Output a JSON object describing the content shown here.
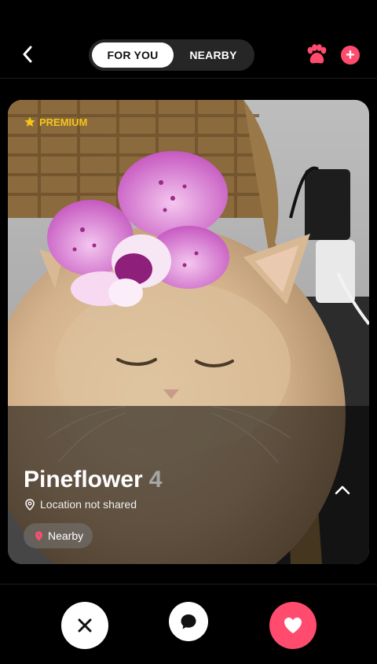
{
  "colors": {
    "accent": "#ff4b6e",
    "premium": "#f5c518",
    "background": "#000000"
  },
  "header": {
    "back_icon": "chevron-left-icon",
    "tabs": [
      {
        "label": "FOR YOU",
        "active": true
      },
      {
        "label": "NEARBY",
        "active": false
      }
    ],
    "paw_icon": "paw-icon",
    "add_icon": "plus-circle-icon",
    "add_glyph": "+"
  },
  "profile": {
    "badge": "PREMIUM",
    "name": "Pineflower",
    "age": "4",
    "location": "Location not shared",
    "chip": "Nearby",
    "expand_icon": "chevron-up-icon"
  },
  "actions": [
    {
      "name": "pass",
      "icon": "close-icon"
    },
    {
      "name": "chat",
      "icon": "chat-bubble-icon"
    },
    {
      "name": "like",
      "icon": "heart-icon"
    }
  ]
}
